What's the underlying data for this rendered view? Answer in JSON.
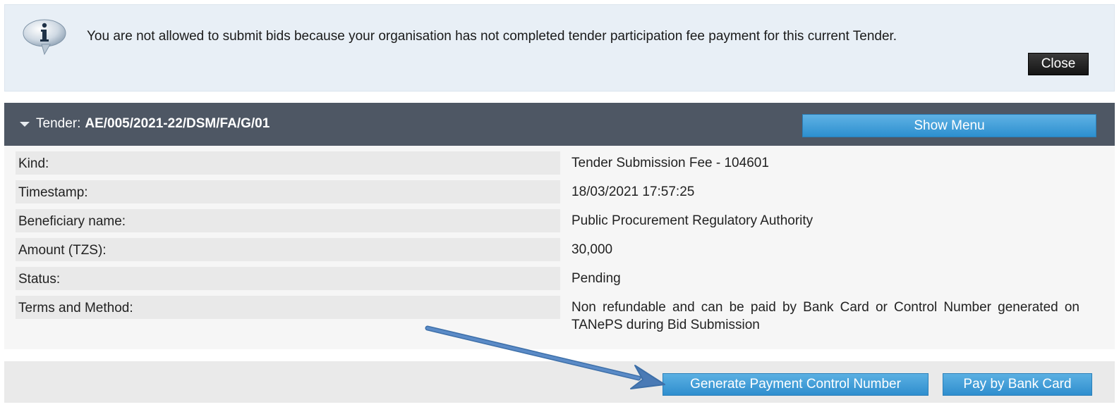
{
  "notice": {
    "message": "You are not allowed to submit bids because your organisation has not completed tender participation fee payment for this current Tender.",
    "close_label": "Close"
  },
  "tender": {
    "prefix": "Tender:",
    "code": "AE/005/2021-22/DSM/FA/G/01",
    "menu_label": "Show Menu"
  },
  "details": [
    {
      "label": "Kind:",
      "value": "Tender Submission Fee - 104601"
    },
    {
      "label": "Timestamp:",
      "value": "18/03/2021 17:57:25"
    },
    {
      "label": "Beneficiary name:",
      "value": "Public Procurement Regulatory Authority"
    },
    {
      "label": "Amount (TZS):",
      "value": "30,000"
    },
    {
      "label": "Status:",
      "value": "Pending"
    },
    {
      "label": "Terms and Method:",
      "value": "Non refundable and can be paid by Bank Card or Control Number generated on TANePS during Bid Submission"
    }
  ],
  "actions": {
    "generate_label": "Generate Payment Control Number",
    "pay_label": "Pay by Bank Card"
  },
  "colors": {
    "header_bar": "#4e5764",
    "button_blue": "#2f8ece",
    "notice_bg": "#e8eff6",
    "arrow": "#4a7ab5"
  }
}
